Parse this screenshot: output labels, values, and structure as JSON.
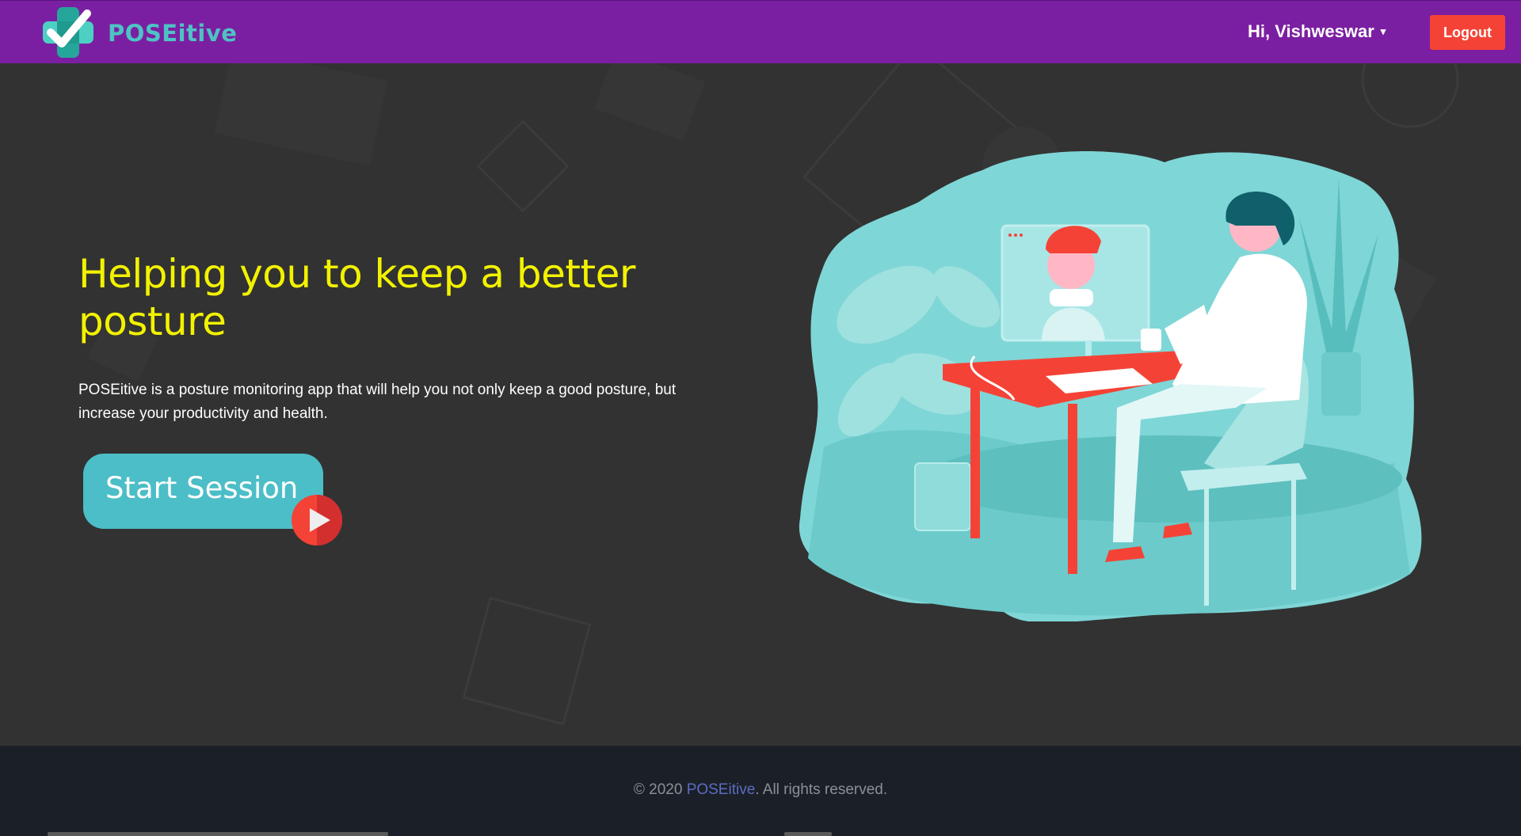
{
  "app": {
    "brand": "POSEitive"
  },
  "header": {
    "greeting": "Hi, Vishweswar",
    "caret": "▾",
    "logout_label": "Logout"
  },
  "hero": {
    "headline": "Helping you to keep a better posture",
    "description": "POSEitive is a posture monitoring app that will help you not only keep a good posture, but increase your productivity and health.",
    "start_label": "Start Session"
  },
  "footer": {
    "prefix": "© 2020 ",
    "brand": "POSEitive",
    "suffix": ". All rights reserved."
  },
  "colors": {
    "header_bg": "#7b1fa2",
    "page_bg": "#323232",
    "headline": "#f2f200",
    "accent_teal": "#4cbec7",
    "logout_red": "#f44336",
    "footer_bg": "#1b2028",
    "footer_link": "#5c6bc0"
  },
  "icons": {
    "logo": "check-cross-logo-icon",
    "dropdown": "caret-down-icon",
    "play": "play-icon"
  }
}
